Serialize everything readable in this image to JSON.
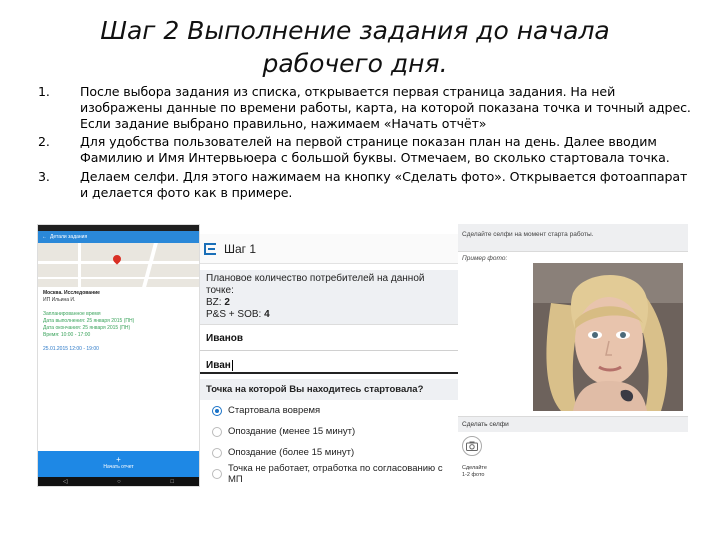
{
  "slide": {
    "title_line1": "Шаг 2 Выполнение задания до начала",
    "title_line2": "рабочего дня.",
    "steps": [
      {
        "num": "1.",
        "text": "После выбора задания из списка, открывается первая страница задания. На ней изображены данные по времени работы, карта, на которой показана точка и  точный адрес. Если задание выбрано правильно, нажимаем «Начать отчёт»"
      },
      {
        "num": "2.",
        "text": "Для удобства пользователей на первой странице показан план на день. Далее вводим Фамилию и Имя Интервьюера с большой буквы. Отмечаем, во сколько стартовала точка."
      },
      {
        "num": "3.",
        "text": "Делаем селфи. Для этого нажимаем на кнопку «Сделать фото». Открывается фотоаппарат и делается фото как в примере."
      }
    ]
  },
  "screen1": {
    "appbar_title": "Детали задания",
    "lines": [
      "Москва. Исследование",
      "ИП Ильина И.",
      "",
      "Запланированное время",
      "Дата выполнения: 25 января 2015 (ПН)",
      "Дата окончания: 25 января 2015 (ПН)",
      "Время: 10:00 - 17:00",
      "",
      "25.01.2015 12:00 - 19:00"
    ],
    "start_button": "Начать отчет",
    "nav": [
      "◁",
      "○",
      "□"
    ]
  },
  "screen2": {
    "header_title": "Шаг 1",
    "plan_label": "Плановое количество потребителей на данной точке:",
    "plan_bz_label": "BZ: ",
    "plan_bz_value": "2",
    "plan_ps_label": "P&S + SOB: ",
    "plan_ps_value": "4",
    "surname_value": "Иванов",
    "name_value": "Иван",
    "question": "Точка на которой Вы находитесь стартовала?",
    "options": [
      "Стартовала вовремя",
      "Опоздание (менее 15 минут)",
      "Опоздание (более 15 минут)",
      "Точка не работает, отработка по согласованию с МП"
    ],
    "selected_index": 0
  },
  "screen3": {
    "top_text": "Сделайте селфи на момент старта работы.",
    "example_label": "Пример фото:",
    "section_label": "Сделать селфи",
    "caption_line1": "Сделайте",
    "caption_line2": "1-2 фото"
  },
  "colors": {
    "accent_blue": "#1e88e5",
    "radio_blue": "#1a73c8",
    "panel_gray": "#eef0f3"
  }
}
